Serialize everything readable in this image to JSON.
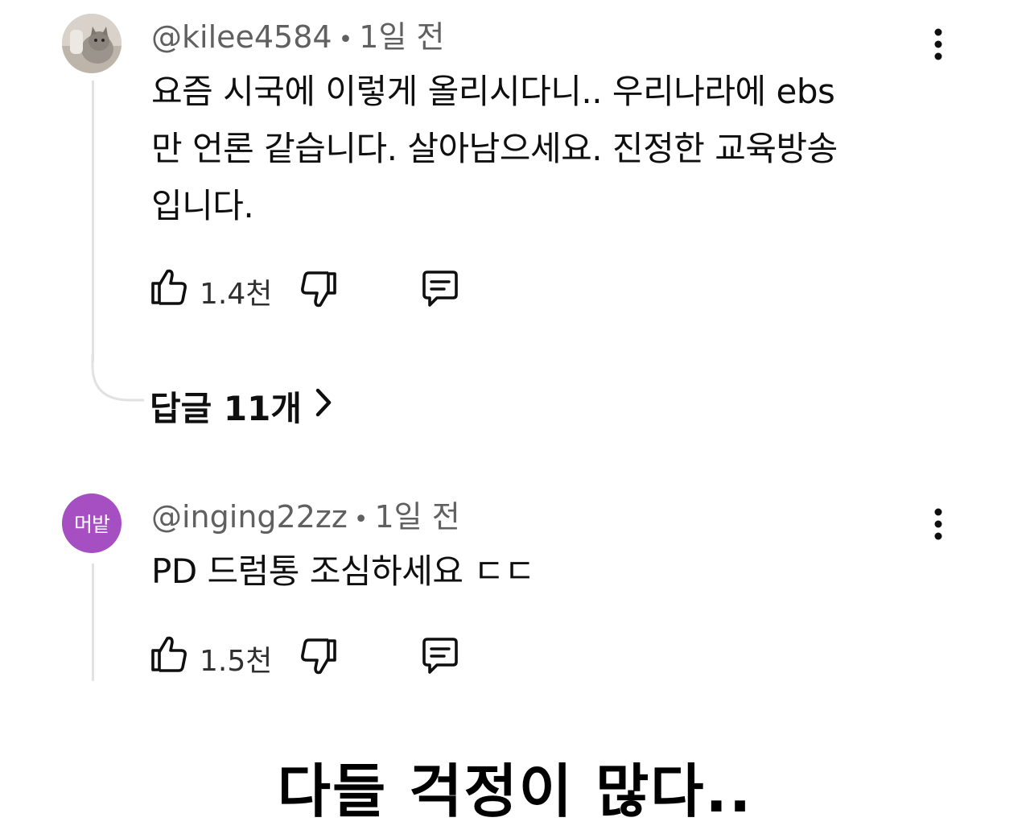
{
  "comments": [
    {
      "handle": "@kilee4584",
      "time": "1일 전",
      "lines": [
        "요즘 시국에 이렇게 올리시다니.. 우리나라에 ebs",
        "만 언론 같습니다. 살아남으세요. 진정한 교육방송",
        "입니다."
      ],
      "likes": "1.4천",
      "avatar_icon": "cat-photo-avatar",
      "replies_label": "답글 11개"
    },
    {
      "handle": "@inging22zz",
      "time": "1일 전",
      "lines": [
        "PD 드럼통 조심하세요 ㄷㄷ"
      ],
      "likes": "1.5천",
      "avatar_text": "머밭",
      "avatar_color": "#a64fc2"
    }
  ],
  "caption": "다들 걱정이 많다..",
  "icons": {
    "like": "thumbs-up-icon",
    "dislike": "thumbs-down-icon",
    "reply": "comment-icon",
    "more": "kebab-menu-icon",
    "replies_chevron": "chevron-right-icon"
  }
}
